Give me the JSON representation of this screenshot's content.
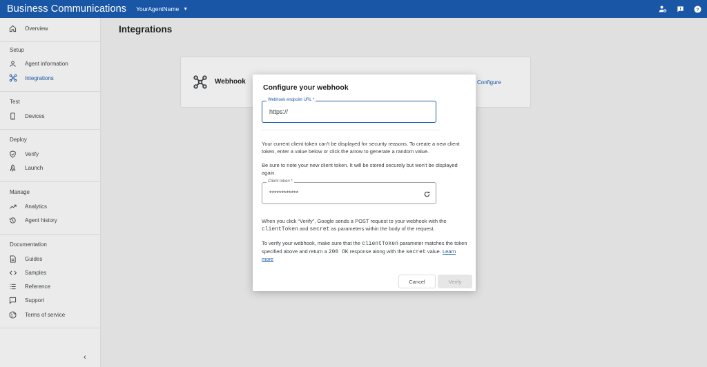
{
  "topbar": {
    "brand": "Business Communications",
    "agent_name": "YourAgentName"
  },
  "sidebar": {
    "overview": "Overview",
    "sections": {
      "setup": "Setup",
      "test": "Test",
      "deploy": "Deploy",
      "manage": "Manage",
      "documentation": "Documentation"
    },
    "items": {
      "agent_information": "Agent information",
      "integrations": "Integrations",
      "devices": "Devices",
      "verify": "Verify",
      "launch": "Launch",
      "analytics": "Analytics",
      "agent_history": "Agent history",
      "guides": "Guides",
      "samples": "Samples",
      "reference": "Reference",
      "support": "Support",
      "terms": "Terms of service"
    },
    "active_item": "integrations"
  },
  "main": {
    "title": "Integrations",
    "card": {
      "title": "Webhook",
      "link": "Configure"
    }
  },
  "dialog": {
    "title": "Configure your webhook",
    "webhook_field": {
      "label": "Webhook endpoint URL *",
      "value": "https://"
    },
    "para1": "Your current client token can't be displayed for security reasons. To create a new client token, enter a value below or click the arrow to generate a random value.",
    "para2": "Be sure to note your new client token. It will be stored securely but won't be displayed again.",
    "token_field": {
      "label": "Client token *",
      "value": "************"
    },
    "para3": {
      "t1": "When you click “Verify”, Google sends a ",
      "c1": "POST",
      "t2": " request to your webhook with the ",
      "c2": "clientToken",
      "t3": " and ",
      "c3": "secret",
      "t4": " as parameters within the body of the request."
    },
    "para4": {
      "t1": "To verify your webhook, make sure that the ",
      "c1": "clientToken",
      "t2": " parameter matches the token specified above and return a ",
      "c2": "200 OK",
      "t3": " response along with the ",
      "c3": "secret",
      "t4": " value. ",
      "link": "Learn more"
    },
    "cancel_label": "Cancel",
    "verify_label": "Verify"
  },
  "colors": {
    "brand_blue": "#1a56a6",
    "sidebar_bg": "#ebebeb",
    "overlay_bg": "#e0e0e0"
  },
  "icons": {
    "topbar": [
      "person-settings-icon",
      "feedback-icon",
      "help-icon"
    ],
    "card": "webhook-icon",
    "token_field": "refresh-icon"
  }
}
